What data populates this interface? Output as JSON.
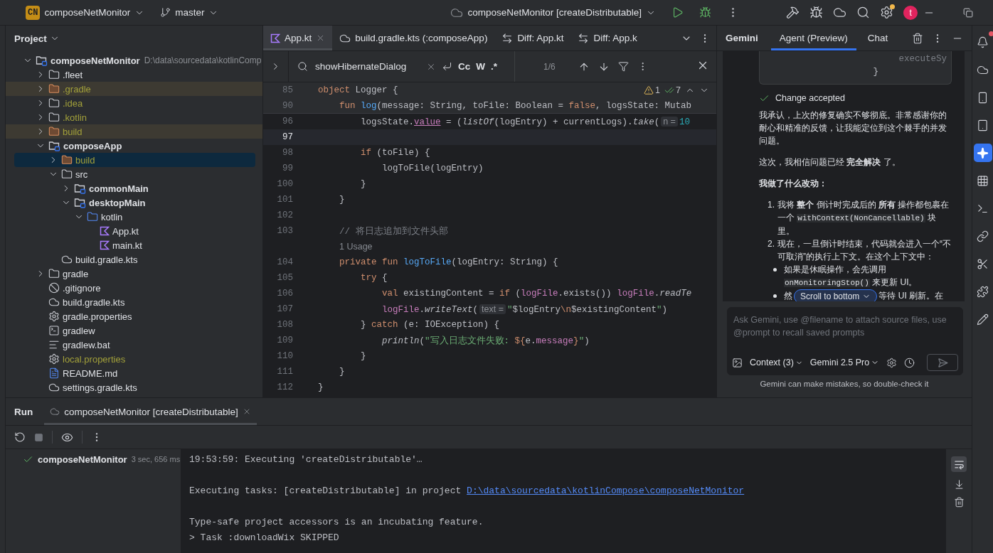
{
  "title_bar": {
    "project_badge": "CN",
    "project": "composeNetMonitor",
    "branch": "master",
    "run_config": "composeNetMonitor [createDistributable]",
    "settings_badge": true,
    "avatar": "t"
  },
  "project_panel": {
    "title": "Project",
    "tree": [
      {
        "name": "composeNetMonitor",
        "kind": "module",
        "path": "D:\\data\\sourcedata\\kotlinComp",
        "expanded": true,
        "selected": false,
        "ignored": false,
        "children": [
          {
            "name": ".fleet",
            "kind": "folder",
            "expanded": false,
            "selected": false,
            "ignored": false
          },
          {
            "name": ".gradle",
            "kind": "excluded",
            "expanded": false,
            "selected": false,
            "ignored": true
          },
          {
            "name": ".idea",
            "kind": "folder",
            "expanded": false,
            "selected": false,
            "ignored": true
          },
          {
            "name": ".kotlin",
            "kind": "folder",
            "expanded": false,
            "selected": false,
            "ignored": true
          },
          {
            "name": "build",
            "kind": "excluded",
            "expanded": false,
            "selected": false,
            "ignored": true
          },
          {
            "name": "composeApp",
            "kind": "module",
            "expanded": true,
            "selected": false,
            "ignored": false,
            "children": [
              {
                "name": "build",
                "kind": "excluded",
                "expanded": false,
                "selected": true,
                "ignored": true
              },
              {
                "name": "src",
                "kind": "folder",
                "expanded": true,
                "selected": false,
                "ignored": false,
                "children": [
                  {
                    "name": "commonMain",
                    "kind": "module",
                    "expanded": false,
                    "selected": false,
                    "ignored": false
                  },
                  {
                    "name": "desktopMain",
                    "kind": "module",
                    "expanded": true,
                    "selected": false,
                    "ignored": false,
                    "children": [
                      {
                        "name": "kotlin",
                        "kind": "source",
                        "expanded": true,
                        "selected": false,
                        "ignored": false,
                        "children": [
                          {
                            "name": "App.kt",
                            "kind": "kotlin",
                            "selected": false,
                            "ignored": false
                          },
                          {
                            "name": "main.kt",
                            "kind": "kotlin",
                            "selected": false,
                            "ignored": false
                          }
                        ]
                      }
                    ]
                  }
                ]
              },
              {
                "name": "build.gradle.kts",
                "kind": "gradle",
                "selected": false,
                "ignored": false
              }
            ]
          },
          {
            "name": "gradle",
            "kind": "folder",
            "expanded": false,
            "selected": false,
            "ignored": false
          },
          {
            "name": ".gitignore",
            "kind": "ignore",
            "selected": false,
            "ignored": false
          },
          {
            "name": "build.gradle.kts",
            "kind": "gradle",
            "selected": false,
            "ignored": false
          },
          {
            "name": "gradle.properties",
            "kind": "properties",
            "selected": false,
            "ignored": false
          },
          {
            "name": "gradlew",
            "kind": "script",
            "selected": false,
            "ignored": false
          },
          {
            "name": "gradlew.bat",
            "kind": "text",
            "selected": false,
            "ignored": false
          },
          {
            "name": "local.properties",
            "kind": "properties",
            "selected": false,
            "ignored": true
          },
          {
            "name": "README.md",
            "kind": "markdown",
            "selected": false,
            "ignored": false
          },
          {
            "name": "settings.gradle.kts",
            "kind": "gradle",
            "selected": false,
            "ignored": false
          }
        ]
      }
    ]
  },
  "editor": {
    "tabs": [
      {
        "label": "App.kt",
        "kind": "kotlin",
        "selected": true
      },
      {
        "label": "build.gradle.kts (:composeApp)",
        "kind": "gradle",
        "selected": false
      },
      {
        "label": "Diff: App.kt",
        "kind": "diff",
        "selected": false
      },
      {
        "label": "Diff: App.k",
        "kind": "diff",
        "selected": false
      }
    ],
    "find": {
      "query": "showHibernateDialog",
      "options": [
        "Cc",
        "W",
        ".*"
      ],
      "count": "1/6"
    },
    "inspections": {
      "warnings": "1",
      "weak_warnings": "7"
    },
    "lines": [
      {
        "kind": "code",
        "number": "85",
        "sticky": true,
        "current": false,
        "tokens": [
          {
            "kind": "kw",
            "text": "object"
          },
          {
            "kind": "plain",
            "text": " Logger {"
          }
        ]
      },
      {
        "kind": "code",
        "number": "90",
        "sticky": true,
        "current": false,
        "tokens": [
          {
            "kind": "kw",
            "text": "    fun "
          },
          {
            "kind": "fn",
            "text": "log"
          },
          {
            "kind": "plain",
            "text": "(message: String, toFile: Boolean = "
          },
          {
            "kind": "kw",
            "text": "false"
          },
          {
            "kind": "plain",
            "text": ", logsState: Mutab"
          }
        ]
      },
      {
        "kind": "code",
        "number": "96",
        "sticky": false,
        "current": false,
        "tokens": [
          {
            "kind": "plain",
            "text": "        logsState."
          },
          {
            "kind": "prop",
            "text": "value"
          },
          {
            "kind": "plain",
            "text": " = ("
          },
          {
            "kind": "call",
            "text": "listOf"
          },
          {
            "kind": "plain",
            "text": "(logEntry) + currentLogs)."
          },
          {
            "kind": "call",
            "text": "take"
          },
          {
            "kind": "plain",
            "text": "("
          },
          {
            "kind": "hint",
            "text": "n ="
          },
          {
            "kind": "num",
            "text": "10"
          }
        ]
      },
      {
        "kind": "code",
        "number": "97",
        "sticky": false,
        "current": true
      },
      {
        "kind": "code",
        "number": "98",
        "sticky": false,
        "current": false,
        "tokens": [
          {
            "kind": "kw",
            "text": "        if"
          },
          {
            "kind": "plain",
            "text": " (toFile) {"
          }
        ]
      },
      {
        "kind": "code",
        "number": "99",
        "sticky": false,
        "current": false,
        "tokens": [
          {
            "kind": "plain",
            "text": "            logToFile(logEntry)"
          }
        ]
      },
      {
        "kind": "code",
        "number": "100",
        "sticky": false,
        "current": false,
        "tokens": [
          {
            "kind": "plain",
            "text": "        }"
          }
        ]
      },
      {
        "kind": "code",
        "number": "101",
        "sticky": false,
        "current": false,
        "tokens": [
          {
            "kind": "plain",
            "text": "    }"
          }
        ]
      },
      {
        "kind": "code",
        "number": "102",
        "sticky": false,
        "current": false
      },
      {
        "kind": "code",
        "number": "103",
        "sticky": false,
        "current": false,
        "tokens": [
          {
            "kind": "comment",
            "text": "    // 将日志追加到文件头部"
          }
        ]
      },
      {
        "kind": "usage",
        "text": "1 Usage"
      },
      {
        "kind": "code",
        "number": "104",
        "sticky": false,
        "current": false,
        "tokens": [
          {
            "kind": "kw",
            "text": "    private fun "
          },
          {
            "kind": "fn",
            "text": "logToFile"
          },
          {
            "kind": "plain",
            "text": "(logEntry: String) {"
          }
        ]
      },
      {
        "kind": "code",
        "number": "105",
        "sticky": false,
        "current": false,
        "tokens": [
          {
            "kind": "kw",
            "text": "        try"
          },
          {
            "kind": "plain",
            "text": " {"
          }
        ]
      },
      {
        "kind": "code",
        "number": "106",
        "sticky": false,
        "current": false,
        "tokens": [
          {
            "kind": "kw",
            "text": "            val"
          },
          {
            "kind": "plain",
            "text": " existingContent = "
          },
          {
            "kind": "kw",
            "text": "if"
          },
          {
            "kind": "plain",
            "text": " ("
          },
          {
            "kind": "prop",
            "text": "logFile"
          },
          {
            "kind": "plain",
            "text": ".exists()) "
          },
          {
            "kind": "prop",
            "text": "logFile"
          },
          {
            "kind": "plain",
            "text": "."
          },
          {
            "kind": "call",
            "text": "readTe"
          }
        ]
      },
      {
        "kind": "code",
        "number": "107",
        "sticky": false,
        "current": false,
        "tokens": [
          {
            "kind": "prop",
            "text": "            logFile"
          },
          {
            "kind": "plain",
            "text": "."
          },
          {
            "kind": "call",
            "text": "writeText"
          },
          {
            "kind": "plain",
            "text": "("
          },
          {
            "kind": "hint",
            "text": "text ="
          },
          {
            "kind": "str",
            "text": "\""
          },
          {
            "kind": "plain",
            "text": "$logEntry"
          },
          {
            "kind": "esc",
            "text": "\\n"
          },
          {
            "kind": "plain",
            "text": "$existingContent"
          },
          {
            "kind": "str",
            "text": "\""
          },
          {
            "kind": "plain",
            "text": ")"
          }
        ]
      },
      {
        "kind": "code",
        "number": "108",
        "sticky": false,
        "current": false,
        "tokens": [
          {
            "kind": "plain",
            "text": "        } "
          },
          {
            "kind": "kw",
            "text": "catch"
          },
          {
            "kind": "plain",
            "text": " (e: IOException) {"
          }
        ]
      },
      {
        "kind": "code",
        "number": "109",
        "sticky": false,
        "current": false,
        "tokens": [
          {
            "kind": "call",
            "text": "            println"
          },
          {
            "kind": "plain",
            "text": "("
          },
          {
            "kind": "str",
            "text": "\"写入日志文件失败: "
          },
          {
            "kind": "esc",
            "text": "${"
          },
          {
            "kind": "plain",
            "text": "e."
          },
          {
            "kind": "prop",
            "text": "message"
          },
          {
            "kind": "esc",
            "text": "}"
          },
          {
            "kind": "str",
            "text": "\""
          },
          {
            "kind": "plain",
            "text": ")"
          }
        ]
      },
      {
        "kind": "code",
        "number": "110",
        "sticky": false,
        "current": false,
        "tokens": [
          {
            "kind": "plain",
            "text": "        }"
          }
        ]
      },
      {
        "kind": "code",
        "number": "111",
        "sticky": false,
        "current": false,
        "tokens": [
          {
            "kind": "plain",
            "text": "    }"
          }
        ]
      },
      {
        "kind": "code",
        "number": "112",
        "sticky": false,
        "current": false,
        "tokens": [
          {
            "kind": "plain",
            "text": "}"
          }
        ]
      }
    ]
  },
  "gemini": {
    "title": "Gemini",
    "tabs": [
      {
        "label": "Agent (Preview)",
        "selected": true
      },
      {
        "label": "Chat",
        "selected": false
      }
    ],
    "blocks": [
      {
        "kind": "code",
        "lines": [
          "executeSy",
          "}"
        ]
      },
      {
        "kind": "status",
        "text": "Change accepted"
      },
      {
        "kind": "paragraph",
        "segments": [
          {
            "kind": "text",
            "text": "我承认，上次的修复确实不够彻底。非常感谢你的耐心和精准的反馈，让我能定位到这个棘手的并发问题。"
          }
        ]
      },
      {
        "kind": "paragraph",
        "segments": [
          {
            "kind": "text",
            "text": "这次，我相信问题已经 "
          },
          {
            "kind": "bold",
            "text": "完全解决"
          },
          {
            "kind": "text",
            "text": " 了。"
          }
        ]
      },
      {
        "kind": "heading",
        "text": "我做了什么改动："
      },
      {
        "kind": "ordered",
        "items": [
          {
            "marker": "1.",
            "segments": [
              {
                "kind": "text",
                "text": "我将 "
              },
              {
                "kind": "bold",
                "text": "整个"
              },
              {
                "kind": "text",
                "text": " 倒计时完成后的 "
              },
              {
                "kind": "bold",
                "text": "所有"
              },
              {
                "kind": "text",
                "text": " 操作都包裹在一个 "
              },
              {
                "kind": "code",
                "text": "withContext(NonCancellable)"
              },
              {
                "kind": "text",
                "text": " 块里。"
              }
            ]
          },
          {
            "marker": "2.",
            "segments": [
              {
                "kind": "text",
                "text": "现在，一旦倒计时结束，代码就会进入一个“不可取消”的执行上下文。在这个上下文中："
              }
            ],
            "children": [
              {
                "segments": [
                  {
                    "kind": "text",
                    "text": "如果是休眠操作，会先调用 "
                  },
                  {
                    "kind": "code",
                    "text": "onMonitoringStop()"
                  },
                  {
                    "kind": "text",
                    "text": " 来更新 UI。"
                  }
                ]
              },
              {
                "segments": [
                  {
                    "kind": "text",
                    "text": "然"
                  },
                  {
                    "kind": "gap"
                  },
                  {
                    "kind": "text",
                    "text": "等待 UI 刷新。在"
                  }
                ]
              }
            ]
          }
        ]
      }
    ],
    "scroll_button": "Scroll to bottom",
    "input": {
      "placeholder": "Ask Gemini, use @filename to attach source files, use @prompt to recall saved prompts"
    },
    "context": "Context (3)",
    "model": "Gemini 2.5 Pro",
    "disclaimer": "Gemini can make mistakes, so double-check it"
  },
  "right_toolbar": [
    {
      "kind": "notifications",
      "badge": true,
      "selected": false
    },
    {
      "kind": "gradle",
      "badge": false,
      "selected": false
    },
    {
      "kind": "device-manager",
      "badge": false,
      "selected": false
    },
    {
      "kind": "running-devices",
      "badge": false,
      "selected": false
    },
    {
      "kind": "gemini",
      "badge": false,
      "selected": true
    },
    {
      "kind": "inspection",
      "badge": false,
      "selected": false
    },
    {
      "kind": "sh",
      "badge": false,
      "selected": false
    },
    {
      "kind": "link",
      "badge": false,
      "selected": false
    },
    {
      "kind": "tools",
      "badge": false,
      "selected": false
    },
    {
      "kind": "puzzle",
      "badge": false,
      "selected": false
    },
    {
      "kind": "pencil",
      "badge": false,
      "selected": false
    }
  ],
  "run_panel": {
    "title": "Run",
    "tab": "composeNetMonitor [createDistributable]",
    "tree": {
      "name": "composeNetMonitor",
      "duration": "3 sec, 656 ms",
      "passed": true
    },
    "console": [
      {
        "kind": "text",
        "text": "19:53:59: Executing 'createDistributable'…"
      },
      {
        "kind": "blank"
      },
      {
        "kind": "text",
        "text": "Executing tasks: [createDistributable] in project ",
        "link": "D:\\data\\sourcedata\\kotlinCompose\\composeNetMonitor"
      },
      {
        "kind": "blank"
      },
      {
        "kind": "text",
        "text": "Type-safe project accessors is an incubating feature."
      },
      {
        "kind": "text",
        "text": "> Task :downloadWix SKIPPED"
      }
    ]
  }
}
